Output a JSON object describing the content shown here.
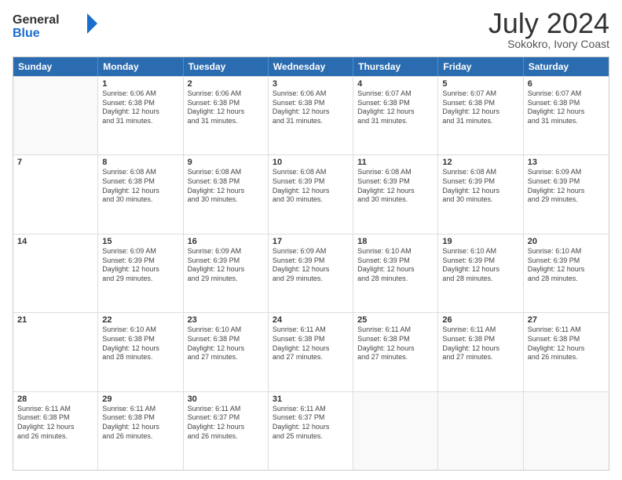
{
  "logo": {
    "general": "General",
    "blue": "Blue"
  },
  "title": "July 2024",
  "subtitle": "Sokokro, Ivory Coast",
  "header_days": [
    "Sunday",
    "Monday",
    "Tuesday",
    "Wednesday",
    "Thursday",
    "Friday",
    "Saturday"
  ],
  "weeks": [
    [
      {
        "day": "",
        "info": ""
      },
      {
        "day": "1",
        "info": "Sunrise: 6:06 AM\nSunset: 6:38 PM\nDaylight: 12 hours\nand 31 minutes."
      },
      {
        "day": "2",
        "info": "Sunrise: 6:06 AM\nSunset: 6:38 PM\nDaylight: 12 hours\nand 31 minutes."
      },
      {
        "day": "3",
        "info": "Sunrise: 6:06 AM\nSunset: 6:38 PM\nDaylight: 12 hours\nand 31 minutes."
      },
      {
        "day": "4",
        "info": "Sunrise: 6:07 AM\nSunset: 6:38 PM\nDaylight: 12 hours\nand 31 minutes."
      },
      {
        "day": "5",
        "info": "Sunrise: 6:07 AM\nSunset: 6:38 PM\nDaylight: 12 hours\nand 31 minutes."
      },
      {
        "day": "6",
        "info": "Sunrise: 6:07 AM\nSunset: 6:38 PM\nDaylight: 12 hours\nand 31 minutes."
      }
    ],
    [
      {
        "day": "7",
        "info": ""
      },
      {
        "day": "8",
        "info": "Sunrise: 6:08 AM\nSunset: 6:38 PM\nDaylight: 12 hours\nand 30 minutes."
      },
      {
        "day": "9",
        "info": "Sunrise: 6:08 AM\nSunset: 6:38 PM\nDaylight: 12 hours\nand 30 minutes."
      },
      {
        "day": "10",
        "info": "Sunrise: 6:08 AM\nSunset: 6:39 PM\nDaylight: 12 hours\nand 30 minutes."
      },
      {
        "day": "11",
        "info": "Sunrise: 6:08 AM\nSunset: 6:39 PM\nDaylight: 12 hours\nand 30 minutes."
      },
      {
        "day": "12",
        "info": "Sunrise: 6:08 AM\nSunset: 6:39 PM\nDaylight: 12 hours\nand 30 minutes."
      },
      {
        "day": "13",
        "info": "Sunrise: 6:09 AM\nSunset: 6:39 PM\nDaylight: 12 hours\nand 29 minutes."
      }
    ],
    [
      {
        "day": "14",
        "info": ""
      },
      {
        "day": "15",
        "info": "Sunrise: 6:09 AM\nSunset: 6:39 PM\nDaylight: 12 hours\nand 29 minutes."
      },
      {
        "day": "16",
        "info": "Sunrise: 6:09 AM\nSunset: 6:39 PM\nDaylight: 12 hours\nand 29 minutes."
      },
      {
        "day": "17",
        "info": "Sunrise: 6:09 AM\nSunset: 6:39 PM\nDaylight: 12 hours\nand 29 minutes."
      },
      {
        "day": "18",
        "info": "Sunrise: 6:10 AM\nSunset: 6:39 PM\nDaylight: 12 hours\nand 28 minutes."
      },
      {
        "day": "19",
        "info": "Sunrise: 6:10 AM\nSunset: 6:39 PM\nDaylight: 12 hours\nand 28 minutes."
      },
      {
        "day": "20",
        "info": "Sunrise: 6:10 AM\nSunset: 6:39 PM\nDaylight: 12 hours\nand 28 minutes."
      }
    ],
    [
      {
        "day": "21",
        "info": ""
      },
      {
        "day": "22",
        "info": "Sunrise: 6:10 AM\nSunset: 6:38 PM\nDaylight: 12 hours\nand 28 minutes."
      },
      {
        "day": "23",
        "info": "Sunrise: 6:10 AM\nSunset: 6:38 PM\nDaylight: 12 hours\nand 27 minutes."
      },
      {
        "day": "24",
        "info": "Sunrise: 6:11 AM\nSunset: 6:38 PM\nDaylight: 12 hours\nand 27 minutes."
      },
      {
        "day": "25",
        "info": "Sunrise: 6:11 AM\nSunset: 6:38 PM\nDaylight: 12 hours\nand 27 minutes."
      },
      {
        "day": "26",
        "info": "Sunrise: 6:11 AM\nSunset: 6:38 PM\nDaylight: 12 hours\nand 27 minutes."
      },
      {
        "day": "27",
        "info": "Sunrise: 6:11 AM\nSunset: 6:38 PM\nDaylight: 12 hours\nand 26 minutes."
      }
    ],
    [
      {
        "day": "28",
        "info": "Sunrise: 6:11 AM\nSunset: 6:38 PM\nDaylight: 12 hours\nand 26 minutes."
      },
      {
        "day": "29",
        "info": "Sunrise: 6:11 AM\nSunset: 6:38 PM\nDaylight: 12 hours\nand 26 minutes."
      },
      {
        "day": "30",
        "info": "Sunrise: 6:11 AM\nSunset: 6:37 PM\nDaylight: 12 hours\nand 26 minutes."
      },
      {
        "day": "31",
        "info": "Sunrise: 6:11 AM\nSunset: 6:37 PM\nDaylight: 12 hours\nand 25 minutes."
      },
      {
        "day": "",
        "info": ""
      },
      {
        "day": "",
        "info": ""
      },
      {
        "day": "",
        "info": ""
      }
    ]
  ]
}
